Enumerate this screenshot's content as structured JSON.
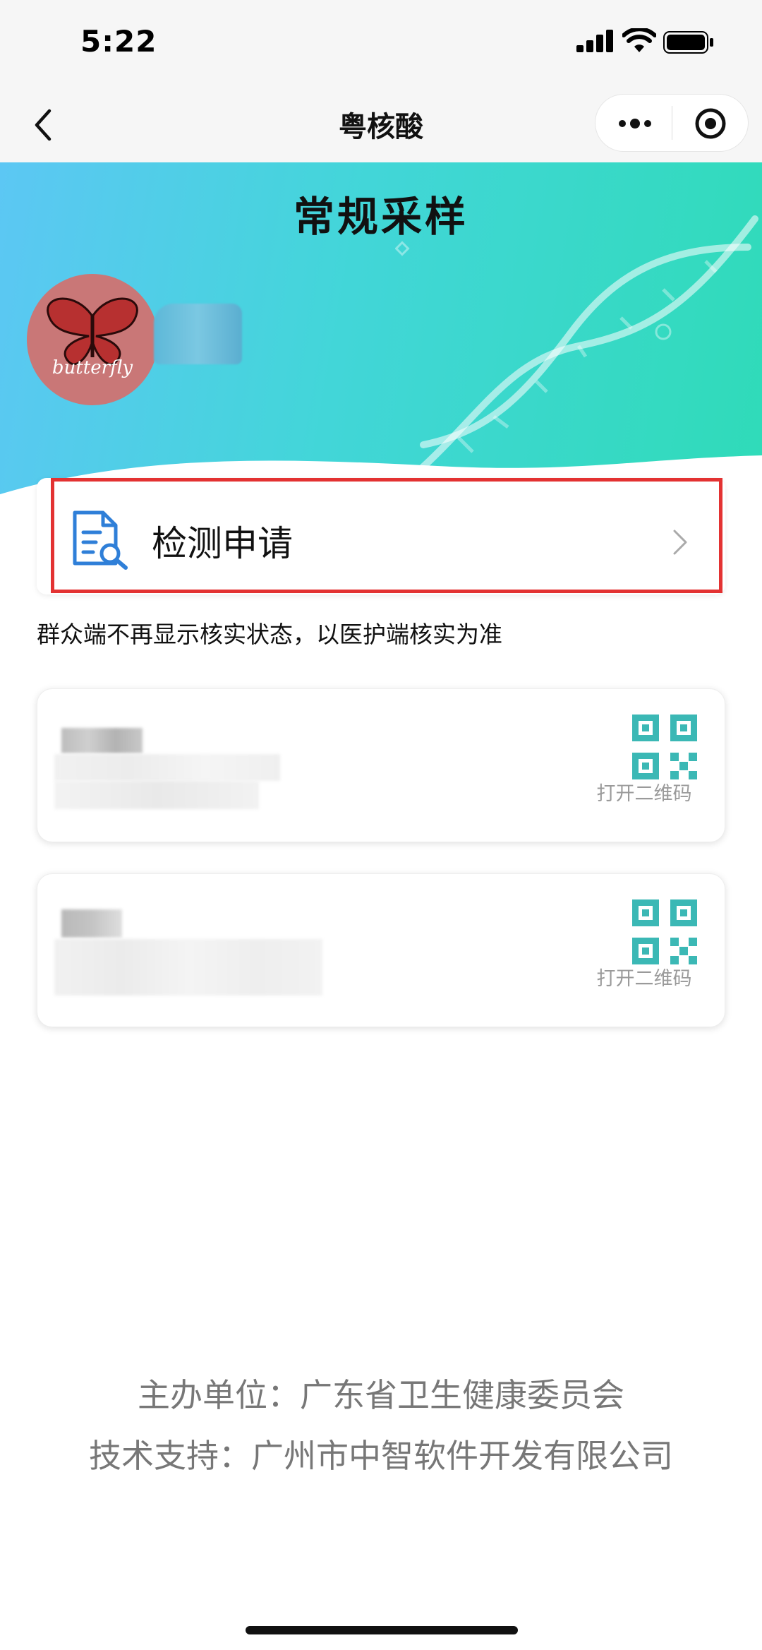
{
  "status_bar": {
    "time": "5:22"
  },
  "nav": {
    "title": "粤核酸"
  },
  "banner": {
    "title": "常规采样",
    "avatar_text": "butterfly"
  },
  "apply": {
    "label": "检测申请"
  },
  "notice": "群众端不再显示核实状态，以医护端核实为准",
  "records": [
    {
      "qr_label": "打开二维码"
    },
    {
      "qr_label": "打开二维码"
    }
  ],
  "footer": {
    "organizer": "主办单位：广东省卫生健康委员会",
    "support": "技术支持：广州市中智软件开发有限公司"
  },
  "colors": {
    "accent": "#3bb8b5",
    "highlight": "#e33232",
    "banner_start": "#5cc7f4",
    "banner_end": "#2fdbb8"
  }
}
